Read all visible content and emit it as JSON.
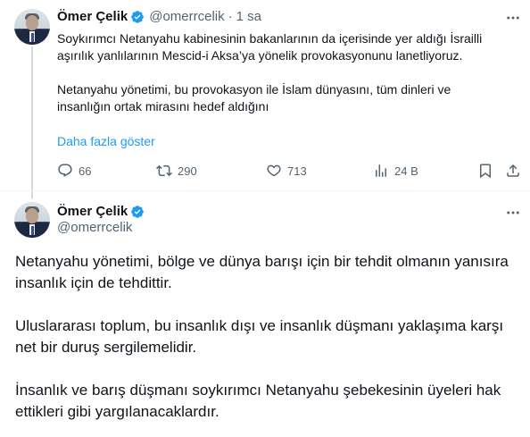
{
  "colors": {
    "accent": "#1d9bf0",
    "secondary_text": "#536471",
    "primary_text": "#0f1419",
    "thread_line": "#cfd9de"
  },
  "tweet_reply": {
    "author_name": "Ömer Çelik",
    "handle": "@omerrcelik",
    "separator": "·",
    "time": "1 sa",
    "paragraphs": [
      "Soykırımcı Netanyahu kabinesinin bakanlarının da içerisinde yer aldığı İsrailli aşırılık yanlılarının Mescid-i Aksa’ya yönelik provokasyonunu lanetliyoruz.",
      "Netanyahu yönetimi, bu provokasyon ile İslam dünyasını, tüm dinleri ve insanlığın ortak mirasını hedef aldığını"
    ],
    "show_more": "Daha fazla göster",
    "actions": {
      "replies": "66",
      "reposts": "290",
      "likes": "713",
      "views": "24 B"
    },
    "icons": [
      "more-icon",
      "reply-icon",
      "repost-icon",
      "like-icon",
      "views-icon",
      "bookmark-icon",
      "share-icon"
    ]
  },
  "tweet_main": {
    "author_name": "Ömer Çelik",
    "handle": "@omerrcelik",
    "paragraphs": [
      "Netanyahu yönetimi, bölge ve dünya barışı için bir tehdit olmanın yanısıra insanlık için de tehdittir.",
      "Uluslararası toplum, bu insanlık dışı ve insanlık düşmanı yaklaşıma karşı net bir duruş sergilemelidir.",
      "İnsanlık ve barış düşmanı soykırımcı Netanyahu şebekesinin üyeleri  hak ettikleri gibi yargılanacaklardır."
    ]
  }
}
